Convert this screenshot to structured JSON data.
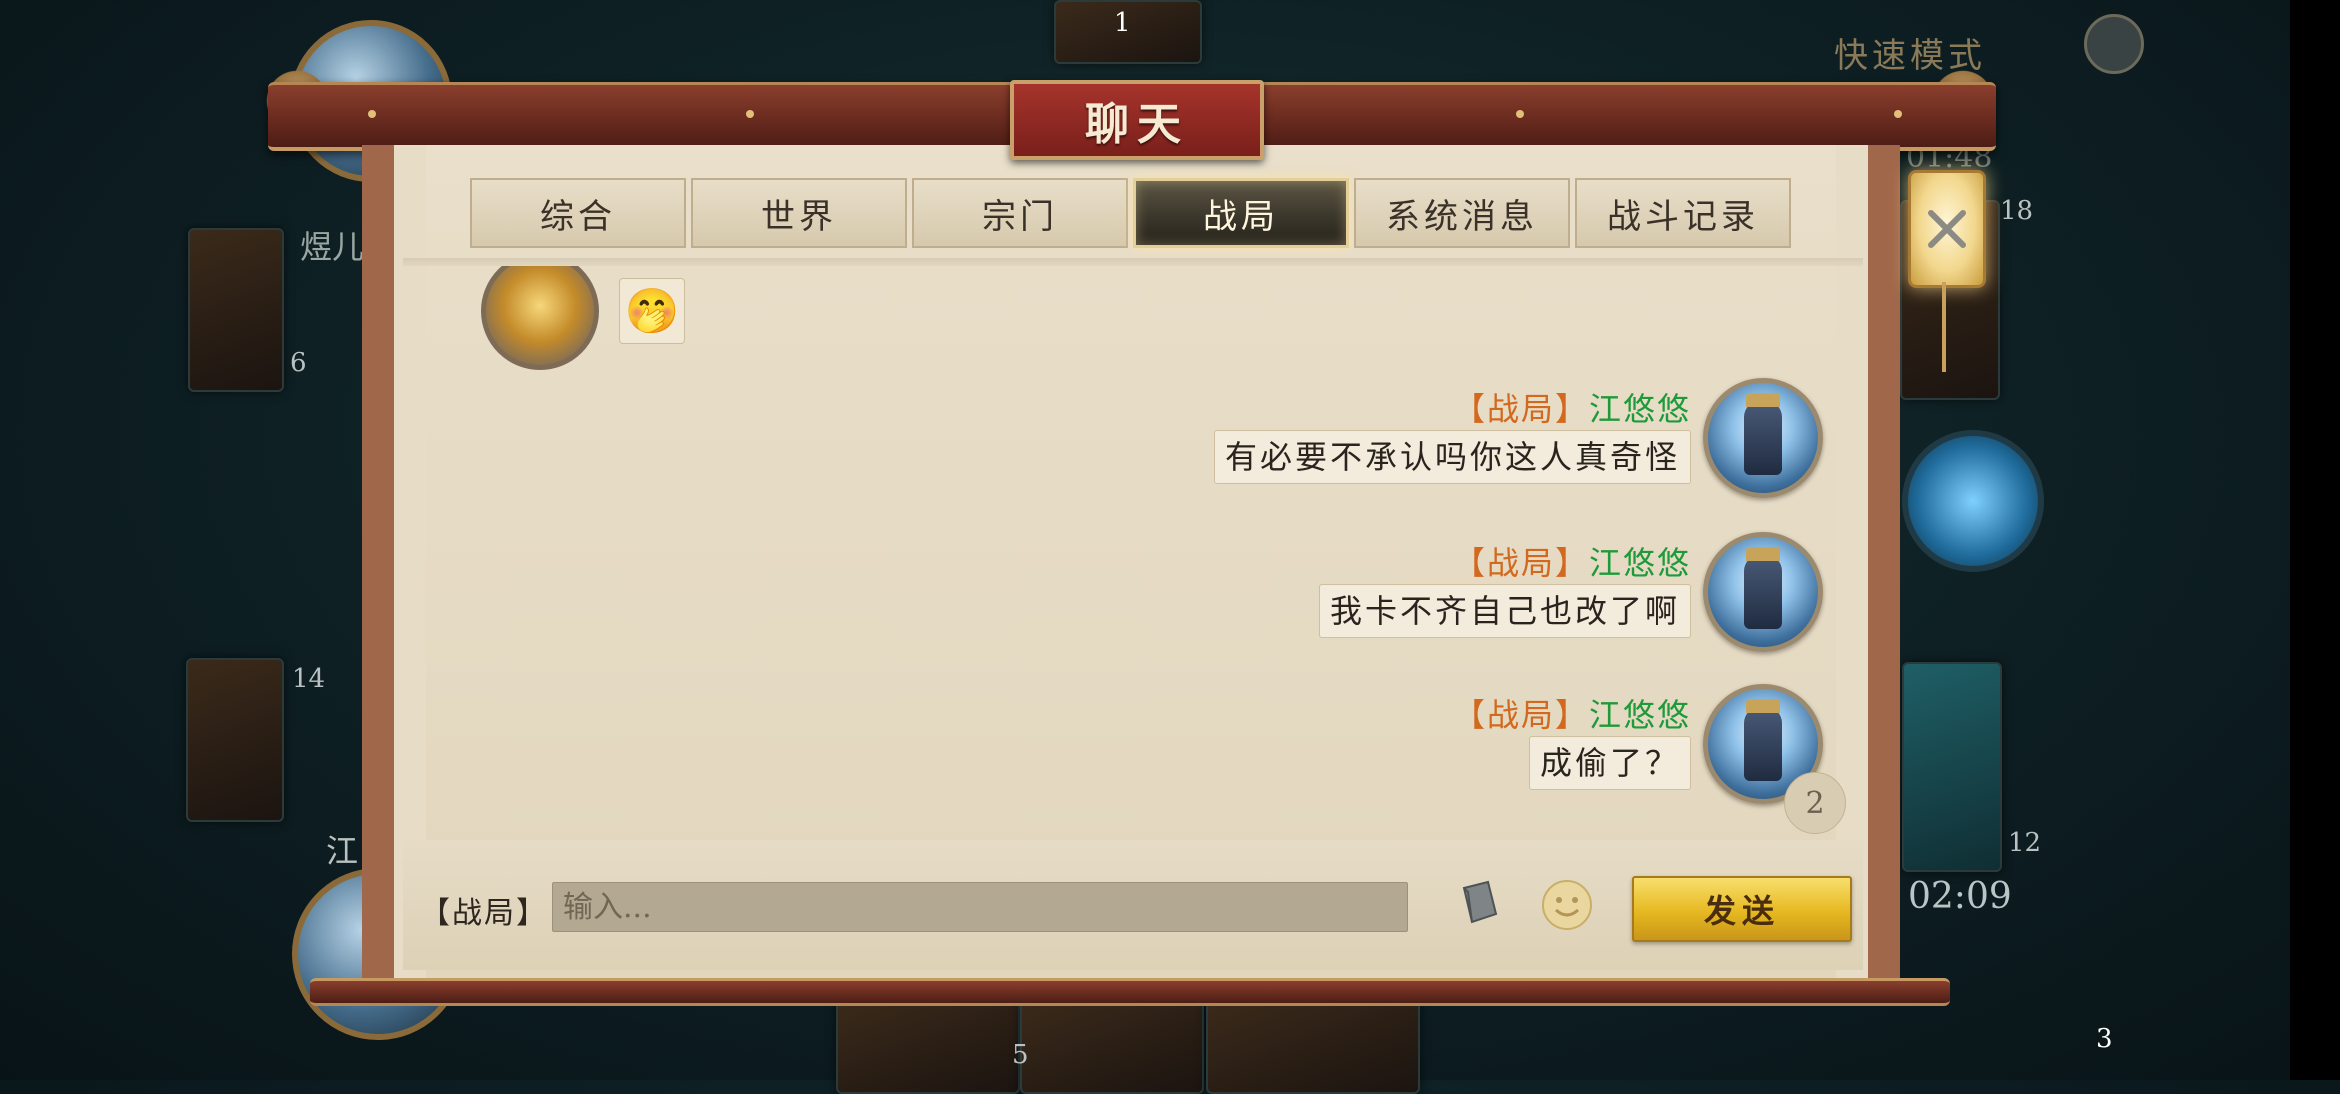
{
  "title": "聊天",
  "tabs": [
    "综合",
    "世界",
    "宗门",
    "战局",
    "系统消息",
    "战斗记录"
  ],
  "active_tab_index": 3,
  "partial_message": {
    "emoji": "🤭"
  },
  "messages": [
    {
      "channel": "【战局】",
      "sender": "江悠悠",
      "text": "有必要不承认吗你这人真奇怪"
    },
    {
      "channel": "【战局】",
      "sender": "江悠悠",
      "text": "我卡不齐自己也改了啊"
    },
    {
      "channel": "【战局】",
      "sender": "江悠悠",
      "text": "成偷了？"
    }
  ],
  "unread_count": "2",
  "input": {
    "channel_label": "【战局】",
    "placeholder": "输入..."
  },
  "send_button": "发送",
  "icons": {
    "close": "close-icon",
    "book": "book-icon",
    "emoji": "smile-icon",
    "quick_note": "document-icon"
  },
  "background": {
    "quick_mode": "快速模式",
    "timer_right": "02:09",
    "timer_top": "01:48",
    "player_left_name": "煜儿",
    "player_left_lower": "江",
    "numbers": {
      "top_card": "1",
      "left_top": "6",
      "left_mid": "14",
      "right_top": "18",
      "right_mid": "12",
      "bottom": "5",
      "bottom_right": "3"
    }
  },
  "colors": {
    "channel": "#d2691e",
    "sender": "#1f9a3a",
    "send_button": "#e6b820",
    "title_plaque": "#a5342b"
  }
}
